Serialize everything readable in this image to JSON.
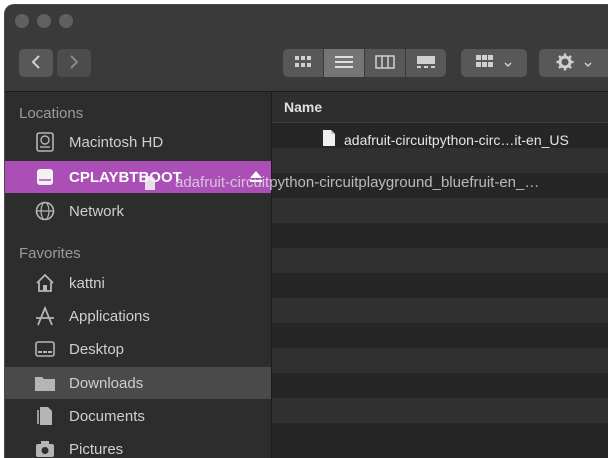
{
  "toolbar": {
    "nav_back": "back",
    "nav_forward": "forward",
    "view_options": [
      "icon-view",
      "list-view",
      "column-view",
      "gallery-view"
    ],
    "group_button": "group",
    "action_button": "action"
  },
  "sidebar": {
    "locations_label": "Locations",
    "favorites_label": "Favorites",
    "locations": [
      {
        "label": "Macintosh HD",
        "icon": "hard-disk-icon"
      },
      {
        "label": "CPLAYBTBOOT",
        "icon": "drive-icon"
      },
      {
        "label": "Network",
        "icon": "network-icon"
      }
    ],
    "favorites": [
      {
        "label": "kattni",
        "icon": "home-icon"
      },
      {
        "label": "Applications",
        "icon": "applications-icon"
      },
      {
        "label": "Desktop",
        "icon": "desktop-icon"
      },
      {
        "label": "Downloads",
        "icon": "downloads-folder-icon"
      },
      {
        "label": "Documents",
        "icon": "documents-icon"
      },
      {
        "label": "Pictures",
        "icon": "pictures-icon"
      }
    ]
  },
  "list": {
    "header_name": "Name",
    "files": [
      {
        "name": "adafruit-circuitpython-circ…it-en_US",
        "icon": "file-icon"
      }
    ]
  },
  "drag": {
    "label": "adafruit-circuitpython-circuitplayground_bluefruit-en_…"
  },
  "colors": {
    "selection_purple": "#a94fb5",
    "sidebar_bg": "#2d2d2d",
    "content_bg": "#262626"
  }
}
